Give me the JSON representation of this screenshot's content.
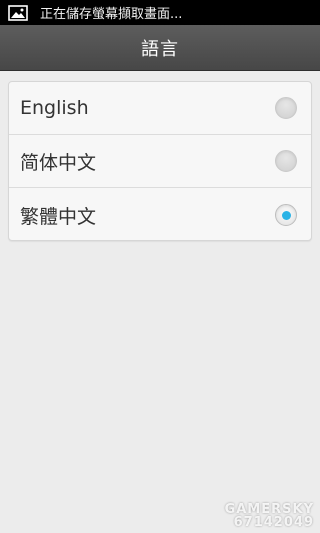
{
  "statusbar": {
    "icon": "image-icon",
    "notification_text": "正在儲存螢幕擷取畫面..."
  },
  "actionbar": {
    "title": "語言"
  },
  "languages": {
    "items": [
      {
        "label": "English",
        "selected": false
      },
      {
        "label": "简体中文",
        "selected": false
      },
      {
        "label": "繁體中文",
        "selected": true
      }
    ]
  },
  "colors": {
    "accent": "#2ab3e6",
    "actionbar": "#505050",
    "background": "#ececec"
  },
  "watermark": {
    "brand": "GAMERSKY",
    "number": "67142049"
  }
}
